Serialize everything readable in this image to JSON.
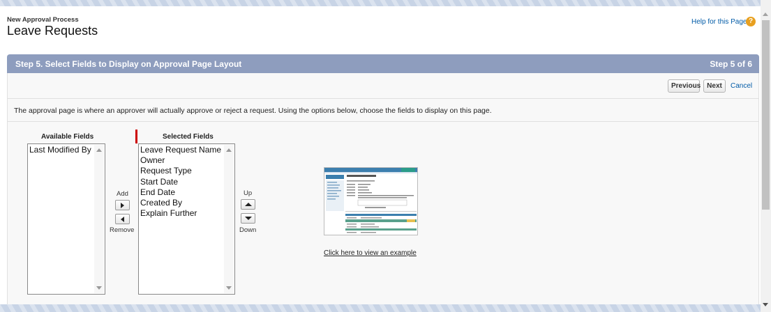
{
  "header": {
    "subtitle": "New Approval Process",
    "title": "Leave Requests",
    "help_link": "Help for this Page",
    "help_icon": "question-circle-icon"
  },
  "step": {
    "title": "Step 5. Select Fields to Display on Approval Page Layout",
    "counter": "Step 5 of 6"
  },
  "buttons": {
    "previous": "Previous",
    "next": "Next",
    "cancel": "Cancel"
  },
  "description": "The approval page is where an approver will actually approve or reject a request. Using the options below, choose the fields to display on this page.",
  "available": {
    "label": "Available Fields",
    "items": [
      "Last Modified By"
    ]
  },
  "selected": {
    "label": "Selected Fields",
    "items": [
      "Leave Request Name",
      "Owner",
      "Request Type",
      "Start Date",
      "End Date",
      "Created By",
      "Explain Further"
    ]
  },
  "transfer": {
    "add": "Add",
    "remove": "Remove"
  },
  "reorder": {
    "up": "Up",
    "down": "Down"
  },
  "example_link": "Click here to view an example",
  "colors": {
    "header_bar": "#8e9dbe",
    "link": "#015ba7",
    "required": "#cc0000"
  }
}
